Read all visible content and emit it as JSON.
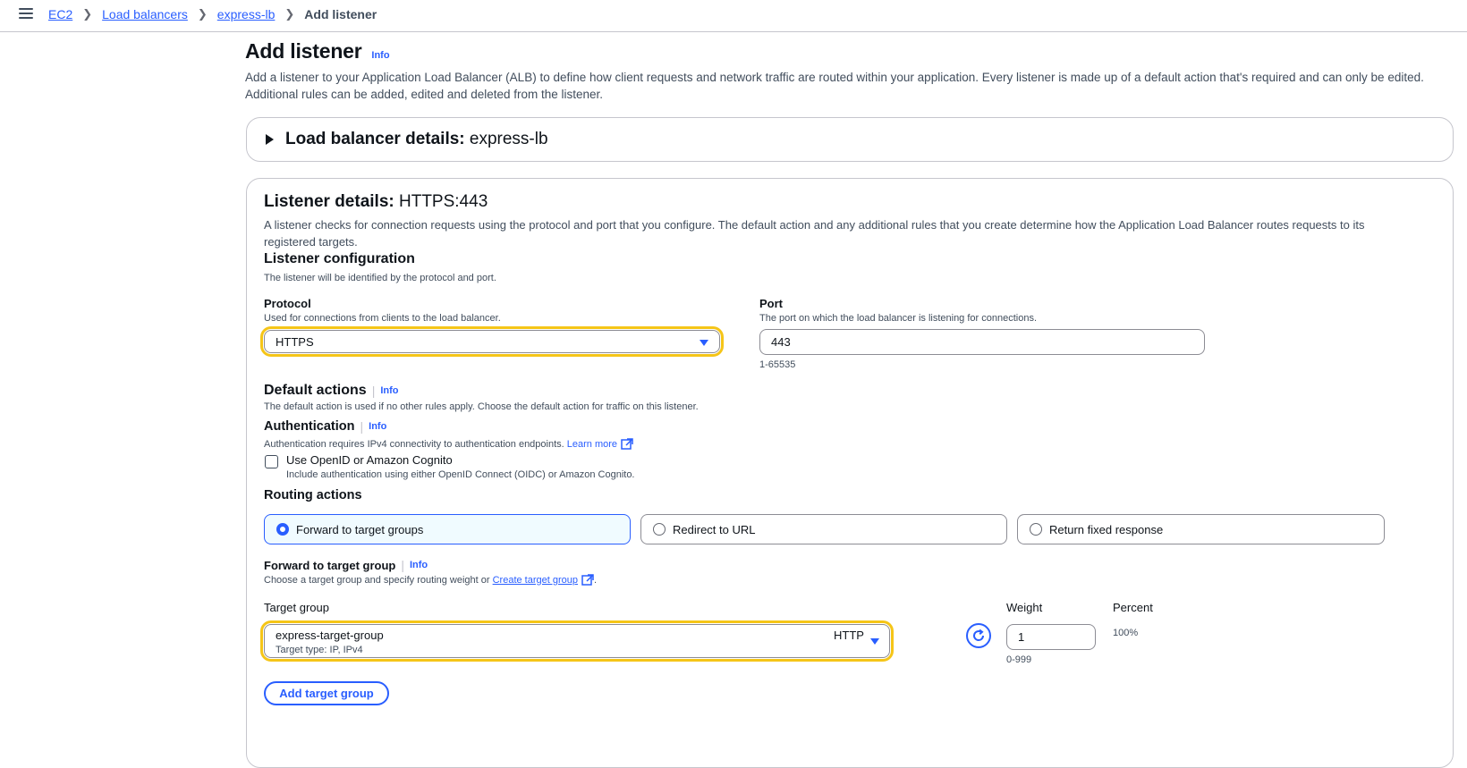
{
  "breadcrumb": {
    "items": [
      "EC2",
      "Load balancers",
      "express-lb"
    ],
    "current": "Add listener"
  },
  "page": {
    "title": "Add listener",
    "info": "Info",
    "description_line1": "Add a listener to your Application Load Balancer (ALB) to define how client requests and network traffic are routed within your application. Every listener is made up of a default action that's required and can only be edited.",
    "description_line2": "Additional rules can be added, edited and deleted from the listener."
  },
  "lb_details": {
    "label": "Load balancer details:",
    "value": "express-lb"
  },
  "listener": {
    "label": "Listener details:",
    "value": "HTTPS:443",
    "description_line1": "A listener checks for connection requests using the protocol and port that you configure. The default action and any additional rules that you create determine how the Application Load Balancer routes requests to its",
    "description_line2": "registered targets.",
    "config_title": "Listener configuration",
    "config_desc": "The listener will be identified by the protocol and port.",
    "protocol": {
      "label": "Protocol",
      "desc": "Used for connections from clients to the load balancer.",
      "value": "HTTPS"
    },
    "port": {
      "label": "Port",
      "desc": "The port on which the load balancer is listening for connections.",
      "value": "443",
      "hint": "1-65535"
    }
  },
  "default_actions": {
    "title": "Default actions",
    "info": "Info",
    "desc": "The default action is used if no other rules apply. Choose the default action for traffic on this listener."
  },
  "authentication": {
    "title": "Authentication",
    "info": "Info",
    "desc": "Authentication requires IPv4 connectivity to authentication endpoints.",
    "learn_more": "Learn more",
    "checkbox_label": "Use OpenID or Amazon Cognito",
    "checkbox_desc": "Include authentication using either OpenID Connect (OIDC) or Amazon Cognito.",
    "checked": false
  },
  "routing": {
    "title": "Routing actions",
    "options": [
      "Forward to target groups",
      "Redirect to URL",
      "Return fixed response"
    ],
    "selected": "Forward to target groups"
  },
  "forward": {
    "title": "Forward to target group",
    "info": "Info",
    "desc": "Choose a target group and specify routing weight or",
    "create_link": "Create target group",
    "desc_end": ".",
    "target_group_label": "Target group",
    "target_group_name": "express-target-group",
    "target_group_protocol": "HTTP",
    "target_group_type": "Target type: IP, IPv4",
    "weight_label": "Weight",
    "weight_value": "1",
    "weight_hint": "0-999",
    "percent_label": "Percent",
    "percent_value": "100%",
    "add_button": "Add target group"
  },
  "colors": {
    "accent": "#295eff",
    "highlight": "#f5c518",
    "text": "#0f141a",
    "muted": "#414d5c"
  }
}
